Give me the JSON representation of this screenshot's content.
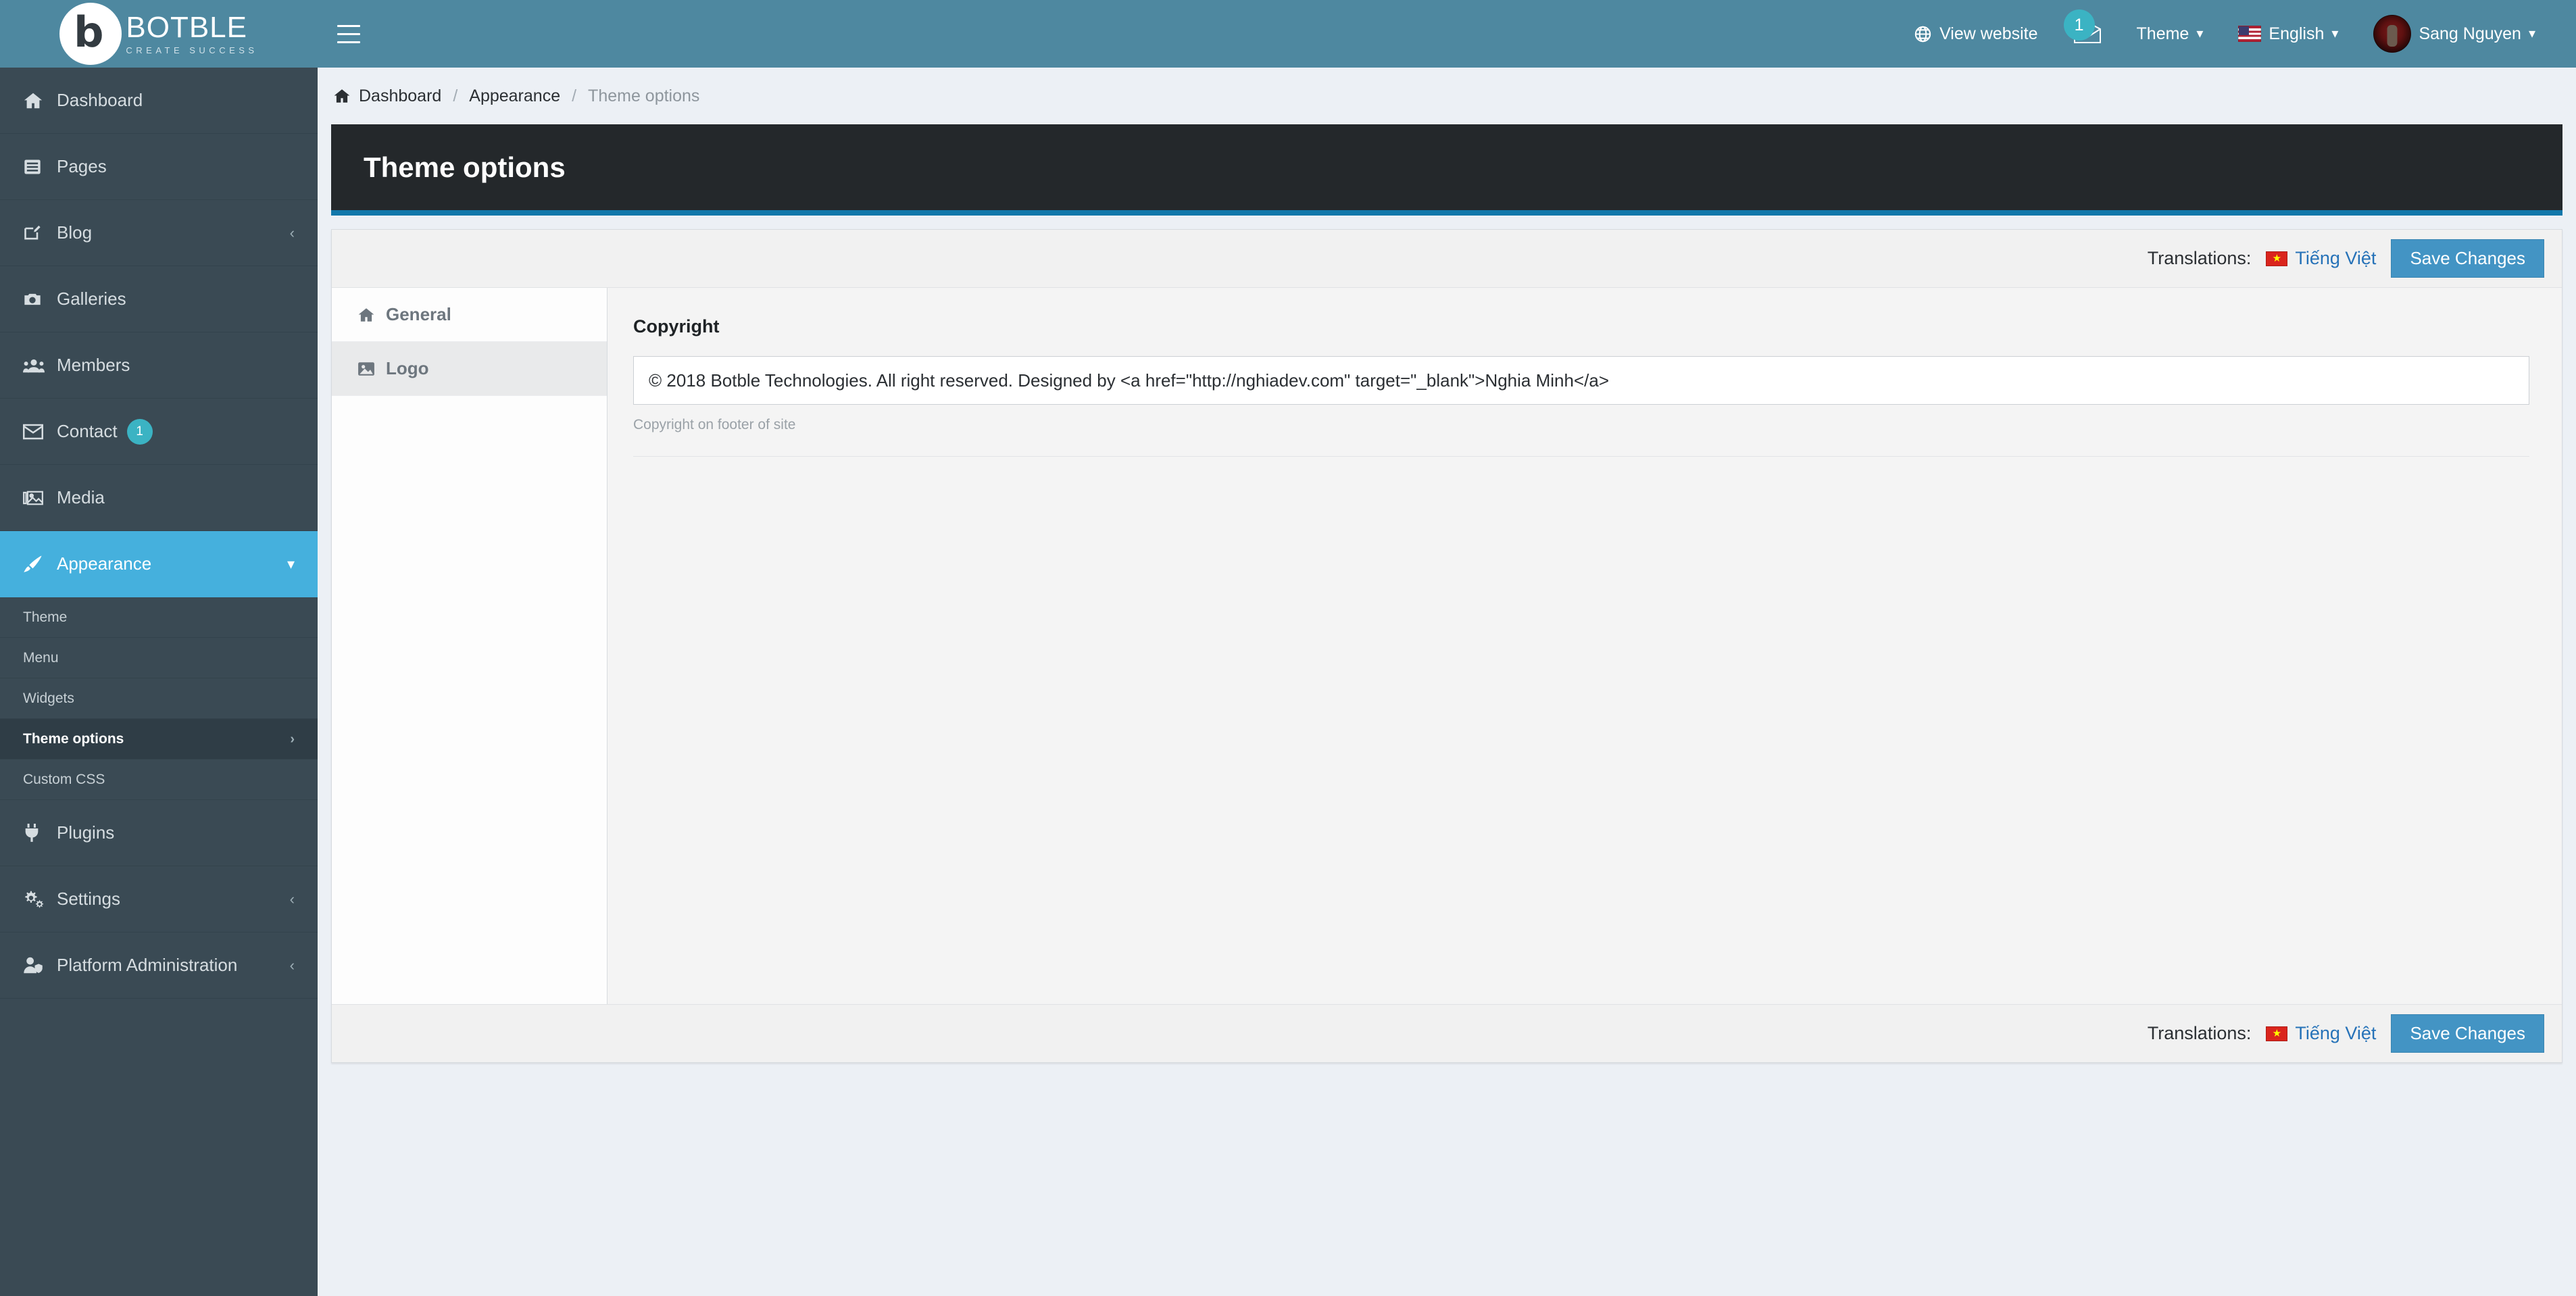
{
  "brand": {
    "name": "BOTBLE",
    "tagline": "CREATE SUCCESS"
  },
  "topbar": {
    "view_website": "View website",
    "messages_badge": "1",
    "theme_label": "Theme",
    "language_label": "English",
    "user_name": "Sang Nguyen",
    "caret": "⌄"
  },
  "sidebar": {
    "items": [
      {
        "label": "Dashboard",
        "icon": "home-icon",
        "badge": "",
        "arrow": "",
        "active": false
      },
      {
        "label": "Pages",
        "icon": "pages-icon",
        "badge": "",
        "arrow": "",
        "active": false
      },
      {
        "label": "Blog",
        "icon": "blog-edit-icon",
        "badge": "",
        "arrow": "‹",
        "active": false
      },
      {
        "label": "Galleries",
        "icon": "camera-icon",
        "badge": "",
        "arrow": "",
        "active": false
      },
      {
        "label": "Members",
        "icon": "members-icon",
        "badge": "",
        "arrow": "",
        "active": false
      },
      {
        "label": "Contact",
        "icon": "envelope-icon",
        "badge": "1",
        "arrow": "",
        "active": false
      },
      {
        "label": "Media",
        "icon": "media-images-icon",
        "badge": "",
        "arrow": "",
        "active": false
      },
      {
        "label": "Appearance",
        "icon": "brush-icon",
        "badge": "",
        "arrow": "⌄",
        "active": true
      }
    ],
    "appearance_submenu": [
      {
        "label": "Theme",
        "arrow": "",
        "selected": false
      },
      {
        "label": "Menu",
        "arrow": "",
        "selected": false
      },
      {
        "label": "Widgets",
        "arrow": "",
        "selected": false
      },
      {
        "label": "Theme options",
        "arrow": "›",
        "selected": true
      },
      {
        "label": "Custom CSS",
        "arrow": "",
        "selected": false
      }
    ],
    "items_after": [
      {
        "label": "Plugins",
        "icon": "plug-icon",
        "badge": "",
        "arrow": "",
        "active": false
      },
      {
        "label": "Settings",
        "icon": "gears-icon",
        "badge": "",
        "arrow": "‹",
        "active": false
      },
      {
        "label": "Platform Administration",
        "icon": "user-shield-icon",
        "badge": "",
        "arrow": "‹",
        "active": false
      }
    ]
  },
  "breadcrumb": {
    "home": "Dashboard",
    "sep": "/",
    "parent": "Appearance",
    "current": "Theme options"
  },
  "page": {
    "title": "Theme options"
  },
  "save_bar": {
    "translations_label": "Translations:",
    "translation_link": "Tiếng Việt",
    "save_button": "Save Changes"
  },
  "tabs": [
    {
      "label": "General",
      "icon": "home-icon",
      "active": true
    },
    {
      "label": "Logo",
      "icon": "image-icon",
      "active": false
    }
  ],
  "form": {
    "copyright": {
      "label": "Copyright",
      "value": "© 2018 Botble Technologies. All right reserved. Designed by <a href=\"http://nghiadev.com\" target=\"_blank\">Nghia Minh</a>",
      "help": "Copyright on footer of site"
    }
  },
  "colors": {
    "header_teal": "#4e88a0",
    "sidebar_dark": "#3a4a54",
    "active_blue": "#45b0dd",
    "accent_blue": "#1278aa",
    "button_blue": "#4394c4",
    "badge_teal": "#3bb3c3"
  }
}
